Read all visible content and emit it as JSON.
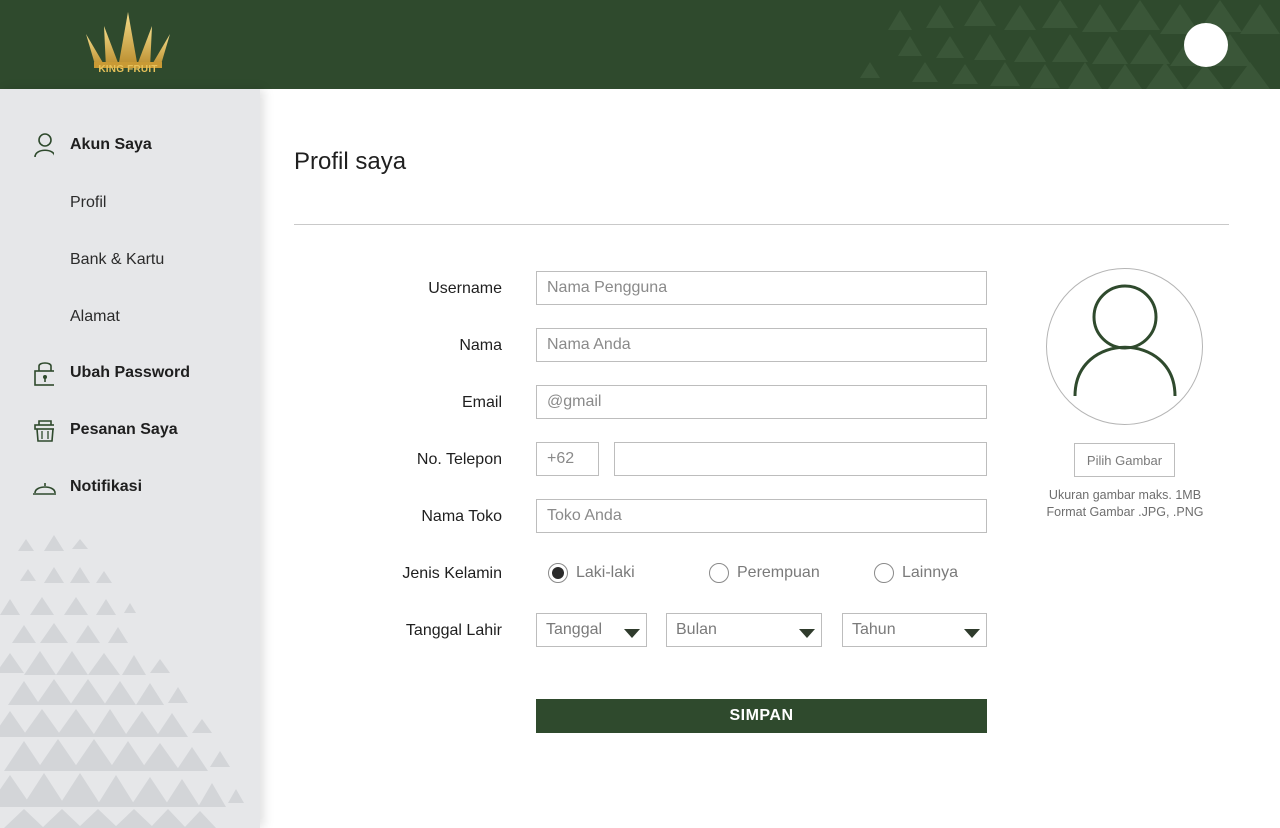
{
  "header": {
    "logo_text": "KING FRUIT",
    "brand_color": "#2f4a2d",
    "accent_gold": "#e7c25a"
  },
  "sidebar": {
    "account_label": "Akun Saya",
    "sub_items": [
      "Profil",
      "Bank & Kartu",
      "Alamat"
    ],
    "change_password_label": "Ubah Password",
    "orders_label": "Pesanan Saya",
    "notifications_label": "Notifikasi",
    "icons": [
      "user-icon",
      "lock-icon",
      "basket-icon",
      "bell-icon"
    ]
  },
  "main": {
    "title": "Profil saya",
    "form": {
      "username_label": "Username",
      "username_placeholder": "Nama Pengguna",
      "name_label": "Nama",
      "name_placeholder": "Nama Anda",
      "email_label": "Email",
      "email_placeholder": "@gmail",
      "phone_label": "No. Telepon",
      "phone_prefix": "+62",
      "phone_value": "",
      "store_label": "Nama Toko",
      "store_placeholder": "Toko Anda",
      "gender_label": "Jenis Kelamin",
      "gender_options": [
        "Laki-laki",
        "Perempuan",
        "Lainnya"
      ],
      "gender_selected": "Laki-laki",
      "birthdate_label": "Tanggal Lahir",
      "day_select": "Tanggal",
      "month_select": "Bulan",
      "year_select": "Tahun",
      "save_label": "SIMPAN"
    },
    "photo": {
      "pick_label": "Pilih Gambar",
      "hint_size": "Ukuran gambar maks. 1MB",
      "hint_format": "Format Gambar .JPG, .PNG"
    }
  }
}
